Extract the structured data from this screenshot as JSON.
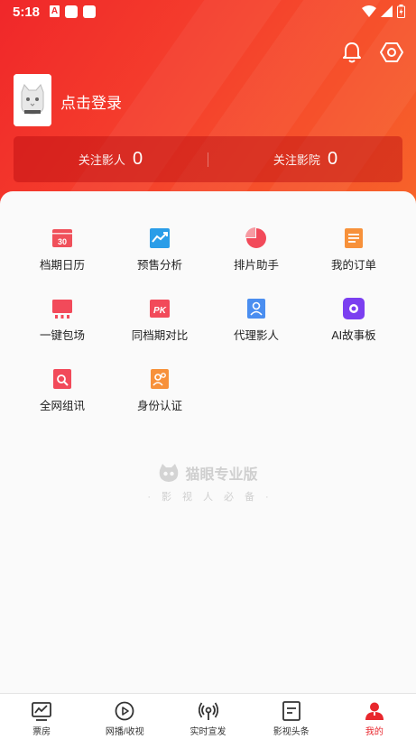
{
  "status_bar": {
    "time": "5:18",
    "a_badge": "A"
  },
  "header": {
    "login_label": "点击登录"
  },
  "follow": {
    "actors_label": "关注影人",
    "actors_count": "0",
    "cinemas_label": "关注影院",
    "cinemas_count": "0"
  },
  "menu": [
    {
      "label": "档期日历",
      "icon": "calendar-icon",
      "color": "#f0505a"
    },
    {
      "label": "预售分析",
      "icon": "trend-chart-icon",
      "color": "#2a9de8"
    },
    {
      "label": "排片助手",
      "icon": "pie-chart-icon",
      "color": "#f24a5a"
    },
    {
      "label": "我的订单",
      "icon": "order-document-icon",
      "color": "#f7913a"
    },
    {
      "label": "一键包场",
      "icon": "screen-booking-icon",
      "color": "#f24a5a"
    },
    {
      "label": "同档期对比",
      "icon": "pk-compare-icon",
      "color": "#f24a5a"
    },
    {
      "label": "代理影人",
      "icon": "agent-person-icon",
      "color": "#4a8ef0"
    },
    {
      "label": "AI故事板",
      "icon": "ai-storyboard-icon",
      "color": "#7b3ff0"
    },
    {
      "label": "全网组讯",
      "icon": "search-document-icon",
      "color": "#f24a5a"
    },
    {
      "label": "身份认证",
      "icon": "identity-icon",
      "color": "#f7913a"
    }
  ],
  "watermark": {
    "title": "猫眼专业版",
    "subtitle": "影视人必备"
  },
  "tabs": [
    {
      "label": "票房",
      "icon": "box-office-icon"
    },
    {
      "label": "网播/收视",
      "icon": "play-icon"
    },
    {
      "label": "实时宣发",
      "icon": "broadcast-icon"
    },
    {
      "label": "影视头条",
      "icon": "news-icon"
    },
    {
      "label": "我的",
      "icon": "profile-icon",
      "active": true
    }
  ]
}
